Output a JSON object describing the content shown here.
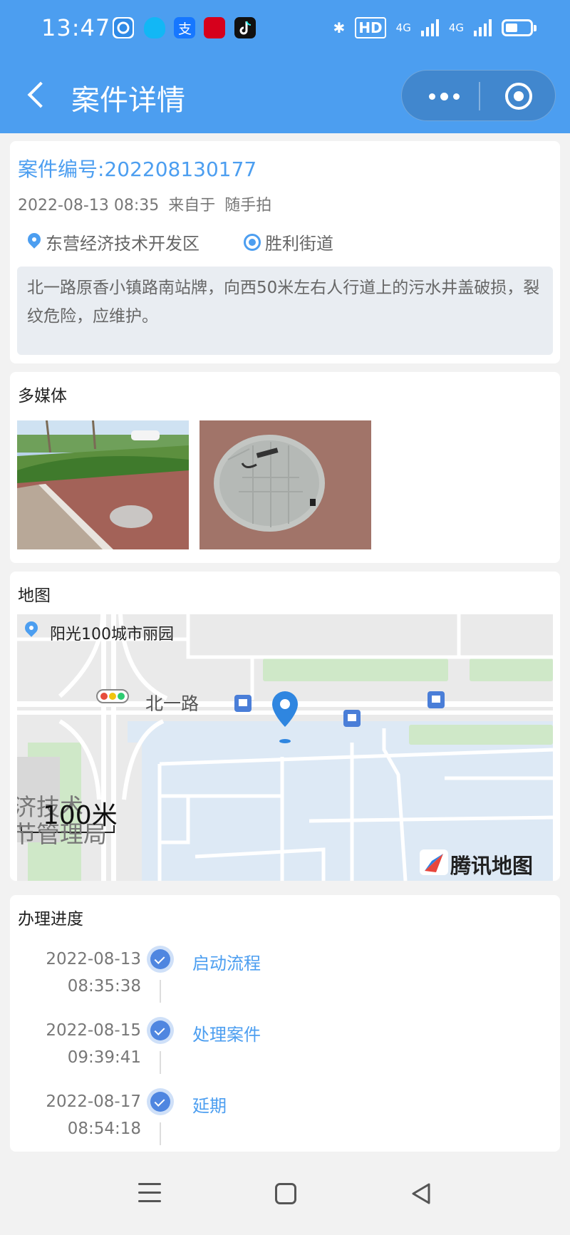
{
  "status_bar": {
    "time": "13:47",
    "app_icons": [
      {
        "name": "camera-app-icon",
        "color": "#2f8ae6"
      },
      {
        "name": "qq-app-icon",
        "color": "#12b7f5"
      },
      {
        "name": "alipay-app-icon",
        "color": "#1677ff"
      },
      {
        "name": "xuexi-app-icon",
        "color": "#d6001c"
      },
      {
        "name": "douyin-app-icon",
        "color": "#111111"
      }
    ],
    "bluetooth": "✱",
    "hd_badge": "HD",
    "network_1": "4G",
    "network_2": "4G"
  },
  "nav": {
    "title": "案件详情"
  },
  "case": {
    "number_label": "案件编号:202208130177",
    "datetime": "2022-08-13 08:35",
    "source_prefix": "来自于",
    "source": "随手拍",
    "district": "东营经济技术开发区",
    "street": "胜利街道",
    "description": "北一路原香小镇路南站牌，向西50米左右人行道上的污水井盖破损，裂纹危险，应维护。"
  },
  "media": {
    "title": "多媒体"
  },
  "map": {
    "title": "地图",
    "place": "阳光100城市丽园",
    "road": "北一路",
    "scale": "100米",
    "faded_label_1": "济技术",
    "faded_label_2": "节管理局",
    "brand": "腾讯地图"
  },
  "progress": {
    "title": "办理进度",
    "steps": [
      {
        "date": "2022-08-13",
        "time": "08:35:38",
        "label": "启动流程"
      },
      {
        "date": "2022-08-15",
        "time": "09:39:41",
        "label": "处理案件"
      },
      {
        "date": "2022-08-17",
        "time": "08:54:18",
        "label": "延期"
      }
    ]
  },
  "colors": {
    "accent": "#4c9ef0",
    "timeline_dot": "#4f86e0"
  }
}
